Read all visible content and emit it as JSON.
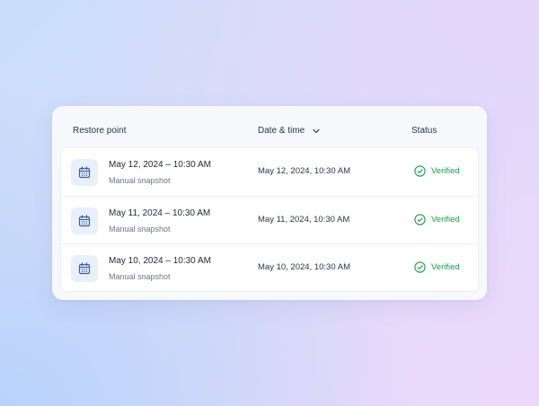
{
  "table": {
    "headers": {
      "restore_point": "Restore point",
      "date_time": "Date & time",
      "status": "Status"
    },
    "rows": [
      {
        "title": "May 12, 2024 – 10:30 AM",
        "subtitle": "Manual snapshot",
        "datetime": "May 12, 2024, 10:30 AM",
        "status": "Verified"
      },
      {
        "title": "May 11, 2024 – 10:30 AM",
        "subtitle": "Manual snapshot",
        "datetime": "May 11, 2024, 10:30 AM",
        "status": "Verified"
      },
      {
        "title": "May 10, 2024 – 10:30 AM",
        "subtitle": "Manual snapshot",
        "datetime": "May 10, 2024, 10:30 AM",
        "status": "Verified"
      }
    ]
  },
  "icons": {
    "row_icon": "calendar-icon",
    "status_icon": "check-circle-icon",
    "sort_icon": "chevron-down-icon"
  },
  "colors": {
    "verified": "#1f9a4b",
    "icon_tint": "#3b5f9e",
    "icon_bg": "#e8f0fc"
  }
}
